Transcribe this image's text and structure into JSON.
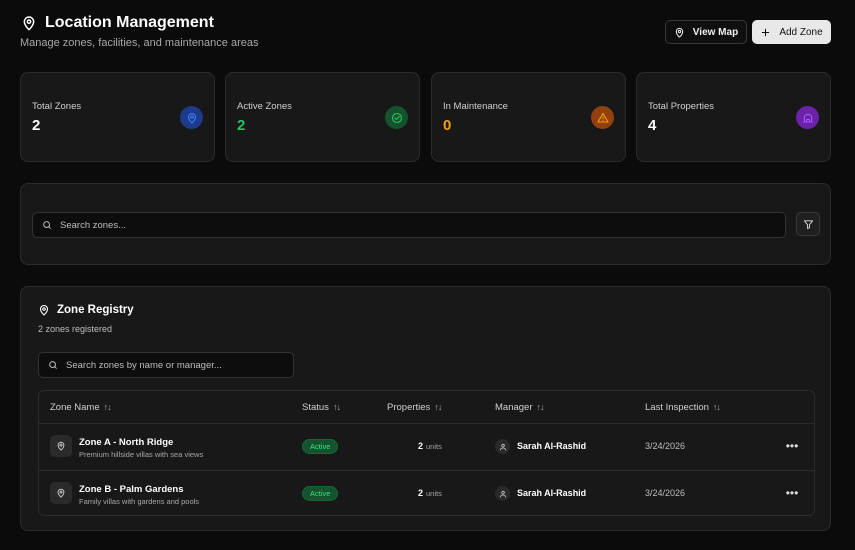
{
  "header": {
    "title": "Location Management",
    "subtitle": "Manage zones, facilities, and maintenance areas",
    "view_map_label": "View Map",
    "add_zone_label": "Add Zone"
  },
  "stats": [
    {
      "label": "Total Zones",
      "value": "2",
      "color": "#ffffff",
      "icon": "map-pin-icon",
      "icon_bg": "#1e3a8a",
      "icon_color": "#3b82f6"
    },
    {
      "label": "Active Zones",
      "value": "2",
      "color": "#22c55e",
      "icon": "check-circle-icon",
      "icon_bg": "#14532d",
      "icon_color": "#22c55e"
    },
    {
      "label": "In Maintenance",
      "value": "0",
      "color": "#f59e0b",
      "icon": "warning-icon",
      "icon_bg": "#92400e",
      "icon_color": "#f59e0b"
    },
    {
      "label": "Total Properties",
      "value": "4",
      "color": "#ffffff",
      "icon": "building-icon",
      "icon_bg": "#6b21a8",
      "icon_color": "#a855f7"
    }
  ],
  "search": {
    "placeholder": "Search zones..."
  },
  "registry": {
    "title": "Zone Registry",
    "subtitle": "2 zones registered",
    "search_placeholder": "Search zones by name or manager...",
    "columns": [
      "Zone Name",
      "Status",
      "Properties",
      "Manager",
      "Last Inspection"
    ],
    "rows": [
      {
        "name": "Zone A - North Ridge",
        "description": "Premium hillside villas with sea views",
        "status": "Active",
        "properties": "2",
        "units_label": "units",
        "manager": "Sarah Al-Rashid",
        "last_inspection": "3/24/2026"
      },
      {
        "name": "Zone B - Palm Gardens",
        "description": "Family villas with gardens and pools",
        "status": "Active",
        "properties": "2",
        "units_label": "units",
        "manager": "Sarah Al-Rashid",
        "last_inspection": "3/24/2026"
      }
    ]
  }
}
